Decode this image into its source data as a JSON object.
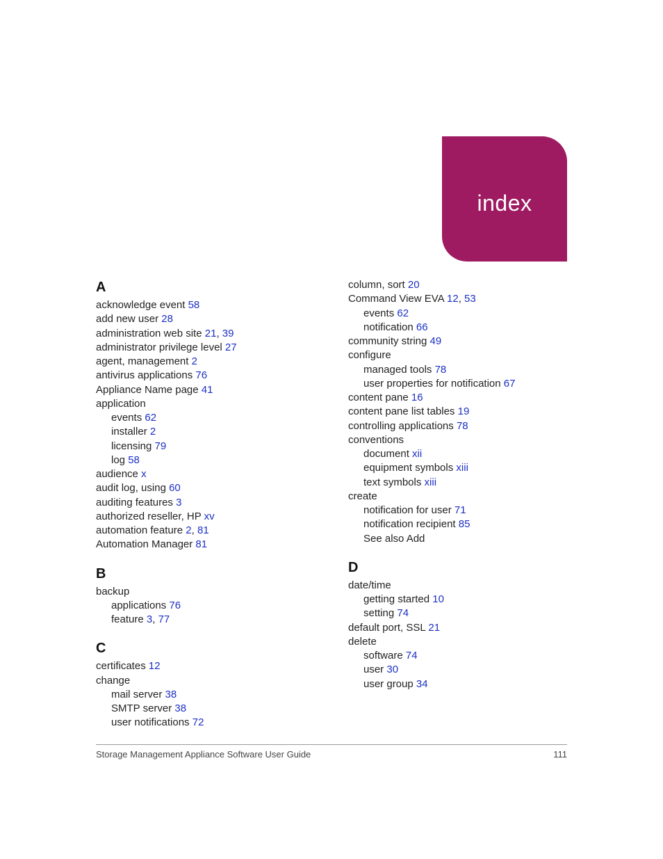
{
  "badge": {
    "title": "index"
  },
  "footer": {
    "left": "Storage Management Appliance Software User Guide",
    "right": "111"
  },
  "left": {
    "A": {
      "heading": "A",
      "items": [
        {
          "t": "acknowledge event ",
          "p": "58"
        },
        {
          "t": "add new user ",
          "p": "28"
        },
        {
          "t": "administration web site ",
          "p": "21",
          "sep": ", ",
          "p2": "39"
        },
        {
          "t": "administrator privilege level ",
          "p": "27"
        },
        {
          "t": "agent, management ",
          "p": "2"
        },
        {
          "t": "antivirus applications ",
          "p": "76"
        },
        {
          "t": "Appliance Name page ",
          "p": "41"
        },
        {
          "t": "application"
        },
        {
          "t": "events ",
          "p": "62",
          "sub": true
        },
        {
          "t": "installer ",
          "p": "2",
          "sub": true
        },
        {
          "t": "licensing ",
          "p": "79",
          "sub": true
        },
        {
          "t": "log ",
          "p": "58",
          "sub": true
        },
        {
          "t": "audience ",
          "p": "x"
        },
        {
          "t": "audit log, using ",
          "p": "60"
        },
        {
          "t": "auditing features ",
          "p": "3"
        },
        {
          "t": "authorized reseller, HP ",
          "p": "xv"
        },
        {
          "t": "automation feature ",
          "p": "2",
          "sep": ", ",
          "p2": "81"
        },
        {
          "t": "Automation Manager ",
          "p": "81"
        }
      ]
    },
    "B": {
      "heading": "B",
      "items": [
        {
          "t": "backup"
        },
        {
          "t": "applications ",
          "p": "76",
          "sub": true
        },
        {
          "t": "feature ",
          "p": "3",
          "sep": ", ",
          "p2": "77",
          "sub": true
        }
      ]
    },
    "C": {
      "heading": "C",
      "items": [
        {
          "t": "certificates ",
          "p": "12"
        },
        {
          "t": "change"
        },
        {
          "t": "mail server ",
          "p": "38",
          "sub": true
        },
        {
          "t": "SMTP server ",
          "p": "38",
          "sub": true
        },
        {
          "t": "user notifications ",
          "p": "72",
          "sub": true
        }
      ]
    }
  },
  "right": {
    "pre": {
      "items": [
        {
          "t": "column, sort ",
          "p": "20"
        },
        {
          "t": "Command View EVA ",
          "p": "12",
          "sep": ", ",
          "p2": "53"
        },
        {
          "t": "events ",
          "p": "62",
          "sub": true
        },
        {
          "t": "notification ",
          "p": "66",
          "sub": true
        },
        {
          "t": "community string ",
          "p": "49"
        },
        {
          "t": "configure"
        },
        {
          "t": "managed tools ",
          "p": "78",
          "sub": true
        },
        {
          "t": "user properties for notification ",
          "p": "67",
          "sub": true
        },
        {
          "t": "content pane ",
          "p": "16"
        },
        {
          "t": "content pane list tables ",
          "p": "19"
        },
        {
          "t": "controlling applications ",
          "p": "78"
        },
        {
          "t": "conventions"
        },
        {
          "t": "document ",
          "p": "xii",
          "sub": true
        },
        {
          "t": "equipment symbols ",
          "p": "xiii",
          "sub": true
        },
        {
          "t": "text symbols ",
          "p": "xiii",
          "sub": true
        },
        {
          "t": "create"
        },
        {
          "t": "notification for user ",
          "p": "71",
          "sub": true
        },
        {
          "t": "notification recipient ",
          "p": "85",
          "sub": true
        },
        {
          "t": "See also Add",
          "sub": true
        }
      ]
    },
    "D": {
      "heading": "D",
      "items": [
        {
          "t": "date/time"
        },
        {
          "t": "getting started ",
          "p": "10",
          "sub": true
        },
        {
          "t": "setting ",
          "p": "74",
          "sub": true
        },
        {
          "t": "default port, SSL ",
          "p": "21"
        },
        {
          "t": "delete"
        },
        {
          "t": "software ",
          "p": "74",
          "sub": true
        },
        {
          "t": "user ",
          "p": "30",
          "sub": true
        },
        {
          "t": "user group ",
          "p": "34",
          "sub": true
        }
      ]
    }
  }
}
